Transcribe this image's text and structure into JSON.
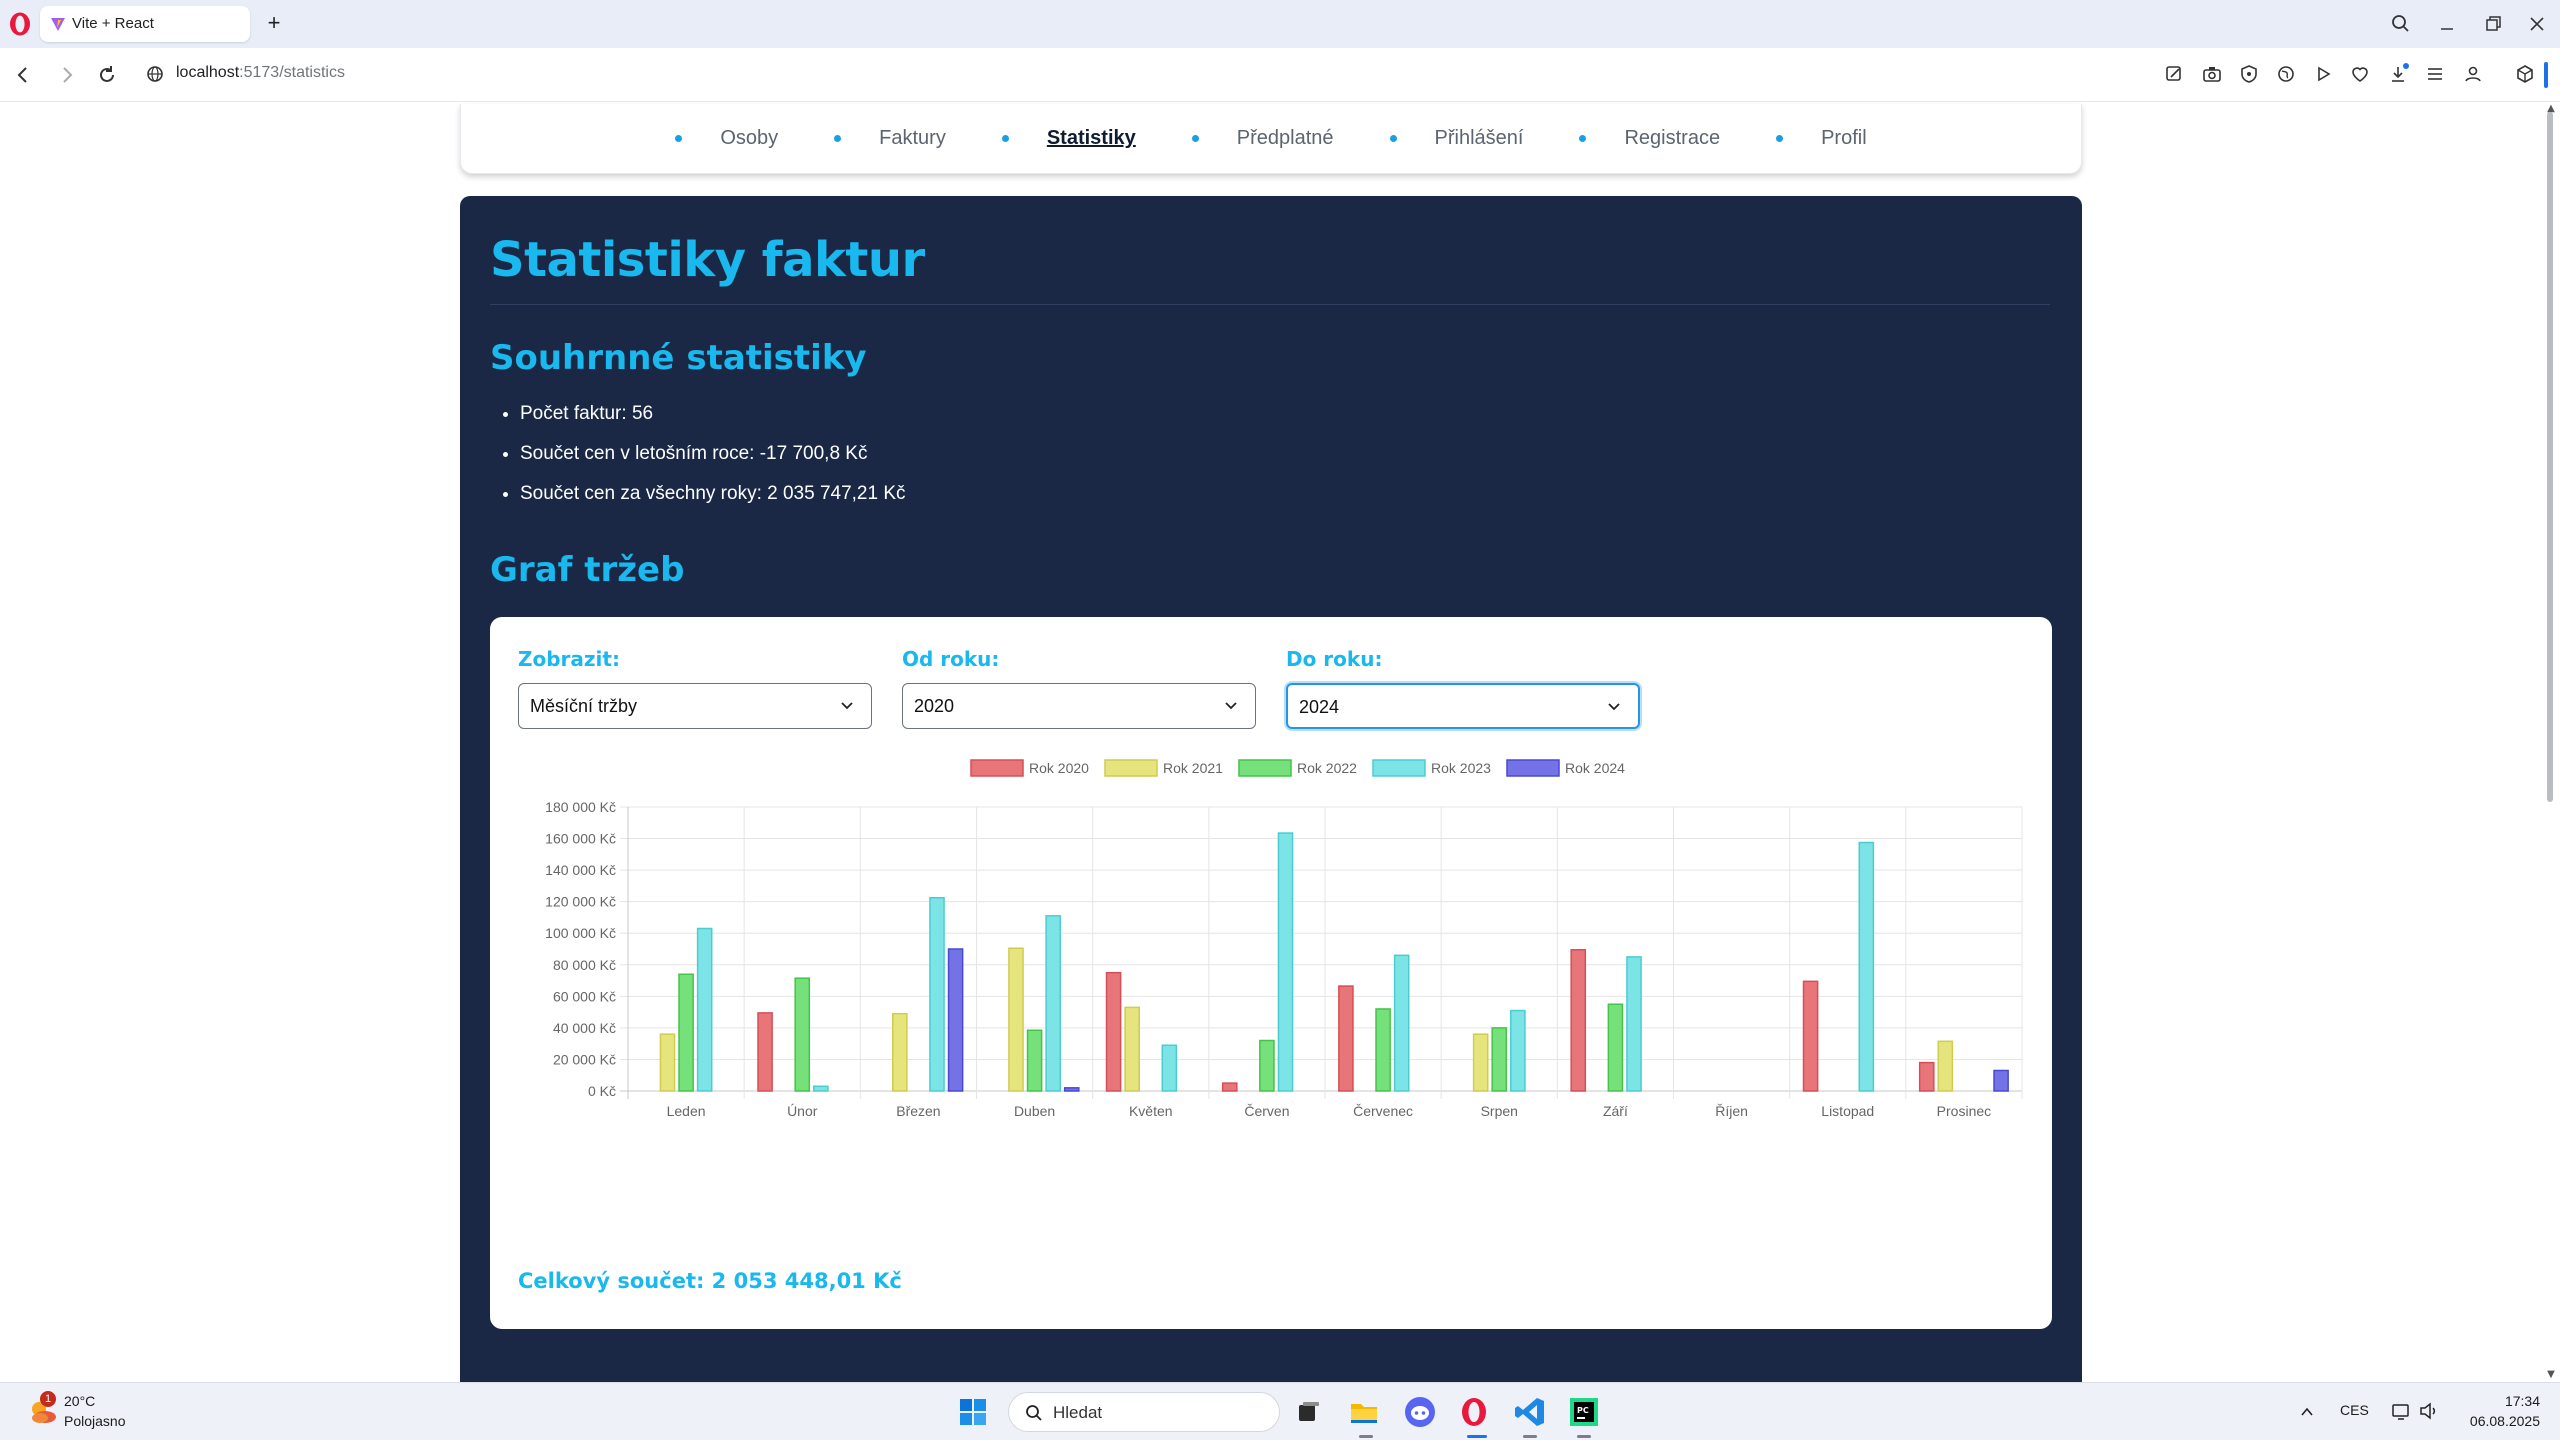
{
  "browser": {
    "tab_title": "Vite + React",
    "url_host": "localhost",
    "url_path": ":5173/statistics"
  },
  "nav": {
    "items": [
      {
        "label": "Osoby",
        "active": false
      },
      {
        "label": "Faktury",
        "active": false
      },
      {
        "label": "Statistiky",
        "active": true
      },
      {
        "label": "Předplatné",
        "active": false
      },
      {
        "label": "Přihlášení",
        "active": false
      },
      {
        "label": "Registrace",
        "active": false
      },
      {
        "label": "Profil",
        "active": false
      }
    ]
  },
  "page": {
    "title": "Statistiky faktur",
    "summary_heading": "Souhrnné statistiky",
    "summary_items": [
      "Počet faktur: 56",
      "Součet cen v letošním roce: -17 700,8 Kč",
      "Součet cen za všechny roky: 2 035 747,21 Kč"
    ],
    "graph_heading": "Graf tržeb",
    "total": "Celkový součet: 2 053 448,01 Kč"
  },
  "filters": {
    "show": {
      "label": "Zobrazit:",
      "value": "Měsíční tržby"
    },
    "from": {
      "label": "Od roku:",
      "value": "2020"
    },
    "to": {
      "label": "Do roku:",
      "value": "2024"
    }
  },
  "colors": {
    "accent": "#19b8ee",
    "panel": "#1b2845",
    "series": [
      "#e8757a",
      "#e6e47c",
      "#76e07a",
      "#7ce3e6",
      "#7372e6"
    ],
    "series_border": [
      "#d64f56",
      "#cfcc4e",
      "#45c449",
      "#4bcdd0",
      "#4a48d2"
    ]
  },
  "chart_data": {
    "type": "bar",
    "categories": [
      "Leden",
      "Únor",
      "Březen",
      "Duben",
      "Květen",
      "Červen",
      "Červenec",
      "Srpen",
      "Září",
      "Říjen",
      "Listopad",
      "Prosinec"
    ],
    "series": [
      {
        "name": "Rok 2020",
        "values": [
          0,
          49500,
          0,
          0,
          75000,
          5000,
          66500,
          0,
          89500,
          0,
          69500,
          18000
        ]
      },
      {
        "name": "Rok 2021",
        "values": [
          36000,
          0,
          49000,
          90500,
          53000,
          0,
          0,
          36000,
          0,
          0,
          0,
          31500
        ]
      },
      {
        "name": "Rok 2022",
        "values": [
          74000,
          71500,
          0,
          38500,
          0,
          32000,
          52000,
          40000,
          55000,
          0,
          0,
          0
        ]
      },
      {
        "name": "Rok 2023",
        "values": [
          103000,
          3000,
          122500,
          111000,
          29000,
          163500,
          86000,
          51000,
          85000,
          0,
          157500,
          0
        ]
      },
      {
        "name": "Rok 2024",
        "values": [
          0,
          0,
          90000,
          2000,
          0,
          0,
          0,
          0,
          0,
          0,
          0,
          13000
        ]
      }
    ],
    "ylim": [
      0,
      180000
    ],
    "yticks": [
      "0 Kč",
      "20 000 Kč",
      "40 000 Kč",
      "60 000 Kč",
      "80 000 Kč",
      "100 000 Kč",
      "120 000 Kč",
      "140 000 Kč",
      "160 000 Kč",
      "180 000 Kč"
    ],
    "legend_position": "top",
    "grid": true
  },
  "taskbar": {
    "weather_temp": "20°C",
    "weather_desc": "Polojasno",
    "weather_badge": "1",
    "search_placeholder": "Hledat",
    "lang": "CES",
    "time": "17:34",
    "date": "06.08.2025"
  }
}
